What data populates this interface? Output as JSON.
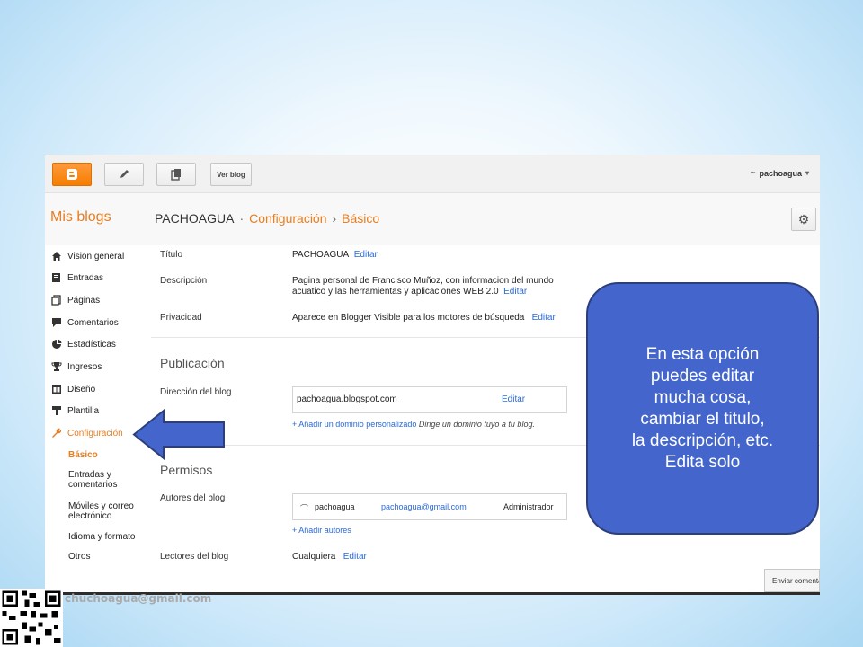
{
  "topbar": {
    "ver_blog": "Ver blog",
    "account_name": "pachoagua",
    "account_icon": "~",
    "account_caret": "▾"
  },
  "header": {
    "mis_blogs": "Mis blogs",
    "blog_name": "PACHOAGUA",
    "crumb_dot": "·",
    "section": "Configuración",
    "crumb_sep": "›",
    "subsection": "Básico",
    "gear_glyph": "⚙"
  },
  "sidebar": {
    "items": [
      {
        "label": "Visión general",
        "icon": "home-icon"
      },
      {
        "label": "Entradas",
        "icon": "posts-icon"
      },
      {
        "label": "Páginas",
        "icon": "pages-icon"
      },
      {
        "label": "Comentarios",
        "icon": "comments-icon"
      },
      {
        "label": "Estadísticas",
        "icon": "stats-icon"
      },
      {
        "label": "Ingresos",
        "icon": "trophy-icon"
      },
      {
        "label": "Diseño",
        "icon": "layout-icon"
      },
      {
        "label": "Plantilla",
        "icon": "paint-roller-icon"
      },
      {
        "label": "Configuración",
        "icon": "wrench-icon"
      }
    ],
    "subitems": [
      {
        "label": "Básico"
      },
      {
        "label": "Entradas y\ncomentarios"
      },
      {
        "label": "Móviles y correo\nelectrónico"
      },
      {
        "label": "Idioma y formato"
      },
      {
        "label": "Otros"
      }
    ]
  },
  "basic": {
    "title_label": "Título",
    "title_value": "PACHOAGUA",
    "edit": "Editar",
    "description_label": "Descripción",
    "description_value": "Pagina personal de Francisco Muñoz, con informacion del mundo acuatico y las herramientas y aplicaciones WEB 2.0",
    "privacy_label": "Privacidad",
    "privacy_value": "Aparece en Blogger Visible para los motores de búsqueda"
  },
  "publication": {
    "title": "Publicación",
    "address_label": "Dirección del blog",
    "address_value": "pachoagua.blogspot.com",
    "edit": "Editar",
    "add_domain": "+ Añadir un dominio personalizado",
    "add_domain_hint": "Dirige un dominio tuyo a tu blog."
  },
  "permissions": {
    "title": "Permisos",
    "authors_label": "Autores del blog",
    "author_name": "pachoagua",
    "author_email": "pachoagua@gmail.com",
    "author_role": "Administrador",
    "add_authors": "+ Añadir autores",
    "readers_label": "Lectores del blog",
    "readers_value": "Cualquiera",
    "readers_edit": "Editar"
  },
  "feedback": {
    "label": "Enviar comentarios"
  },
  "callout": {
    "text": "En esta opción\npuedes editar\nmucha cosa,\ncambiar el titulo,\nla descripción, etc.\nEdita solo"
  },
  "footer": {
    "email": "chuchoagua@gmail.com"
  },
  "colors": {
    "accent": "#e67e22",
    "link": "#2a6ad6",
    "callout": "#4466cc",
    "blogger_orange": "#f57d00"
  }
}
